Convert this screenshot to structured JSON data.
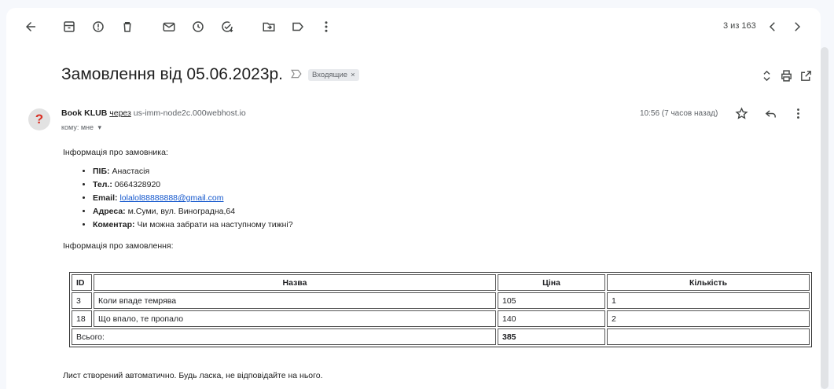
{
  "toolbar": {
    "icons": [
      "back-arrow-icon",
      "archive-icon",
      "report-spam-icon",
      "delete-icon",
      "mark-unread-icon",
      "snooze-icon",
      "add-task-icon",
      "move-to-icon",
      "label-icon",
      "more-vert-icon"
    ],
    "pager_text": "3 из 163"
  },
  "message": {
    "subject": "Замовлення від 05.06.2023р.",
    "chip_label": "Входящие",
    "chip_close": "×",
    "sender_name": "Book KLUB",
    "via_text": "через",
    "sender_address": "us-imm-node2c.000webhost.io",
    "recipient": "кому: мне",
    "time": "10:56 (7 часов назад)",
    "avatar_glyph": "?"
  },
  "body": {
    "customer_heading": "Інформація про замовника:",
    "fields": [
      {
        "label": "ПІБ:",
        "value": "Анастасія"
      },
      {
        "label": "Тел.:",
        "value": "0664328920"
      },
      {
        "label": "Email:",
        "value": "lolalol88888888@gmail.com"
      },
      {
        "label": "Адреса:",
        "value": "м.Суми, вул. Виноградна,64"
      },
      {
        "label": "Коментар:",
        "value": "Чи можна забрати на наступному тижні?"
      }
    ],
    "order_heading": "Інформація про замовлення:",
    "table": {
      "headers": [
        "ID",
        "Назва",
        "Ціна",
        "Кількість"
      ],
      "rows": [
        {
          "id": "3",
          "name": "Коли впаде темрява",
          "price": "105",
          "qty": "1"
        },
        {
          "id": "18",
          "name": "Що впало, те пропало",
          "price": "140",
          "qty": "2"
        }
      ],
      "total_label": "Всього:",
      "total_value": "385"
    },
    "footer": "Лист створений автоматично. Будь ласка, не відповідайте на нього."
  },
  "colors": {
    "background": "#f6f8fc",
    "link": "#1155cc",
    "avatar_glyph": "#d93025"
  }
}
